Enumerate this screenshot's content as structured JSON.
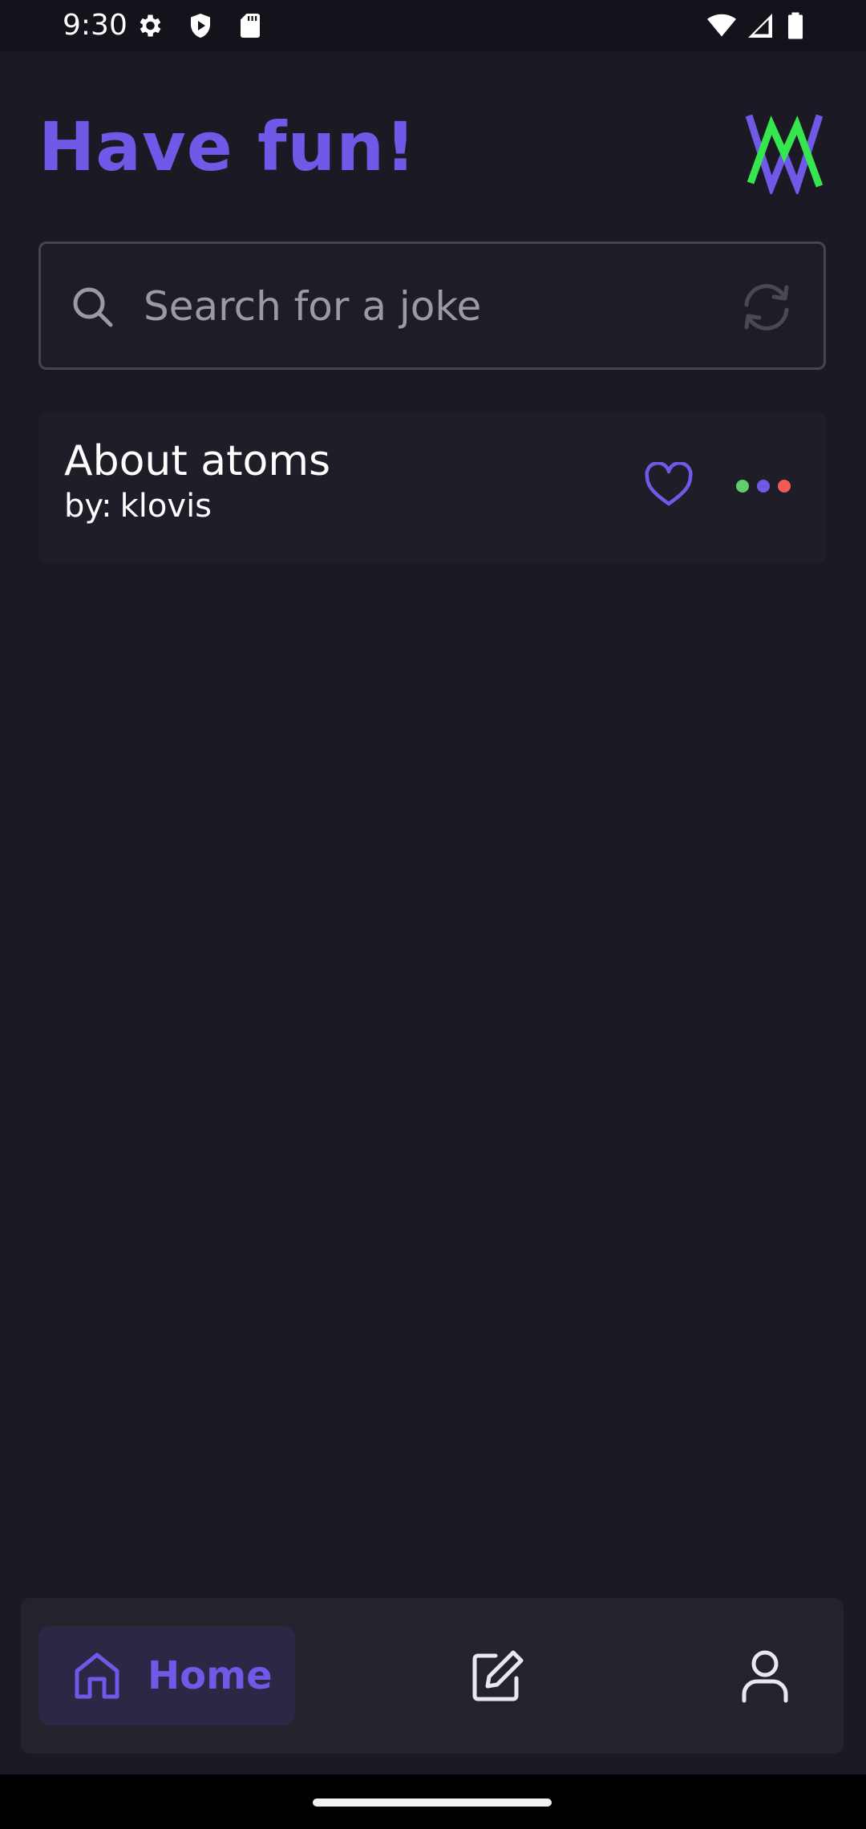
{
  "status_bar": {
    "time": "9:30",
    "left_icons": [
      "gear-icon",
      "shield-play-icon",
      "sd-card-icon"
    ],
    "right_icons": [
      "wifi-icon",
      "cell-signal-icon",
      "battery-icon"
    ]
  },
  "header": {
    "title": "Have fun!",
    "logo": "app-logo-icon"
  },
  "search": {
    "placeholder": "Search for a joke",
    "value": "",
    "left_icon": "search-icon",
    "right_icon": "refresh-icon"
  },
  "jokes": [
    {
      "title": "About atoms",
      "author_prefix": "by:",
      "author": "klovis",
      "favorite_icon": "heart-outline-icon",
      "more_icon": "more-dots-icon"
    }
  ],
  "bottom_nav": {
    "items": [
      {
        "label": "Home",
        "icon": "home-icon",
        "active": true
      },
      {
        "label": "",
        "icon": "edit-icon",
        "active": false
      },
      {
        "label": "",
        "icon": "profile-icon",
        "active": false
      }
    ]
  },
  "colors": {
    "accent": "#6f5ae8",
    "background": "#1b1a24",
    "logo_green": "#36e64f",
    "dot_green": "#5fcf6a",
    "dot_purple": "#6f5ae8",
    "dot_red": "#f25a55"
  }
}
